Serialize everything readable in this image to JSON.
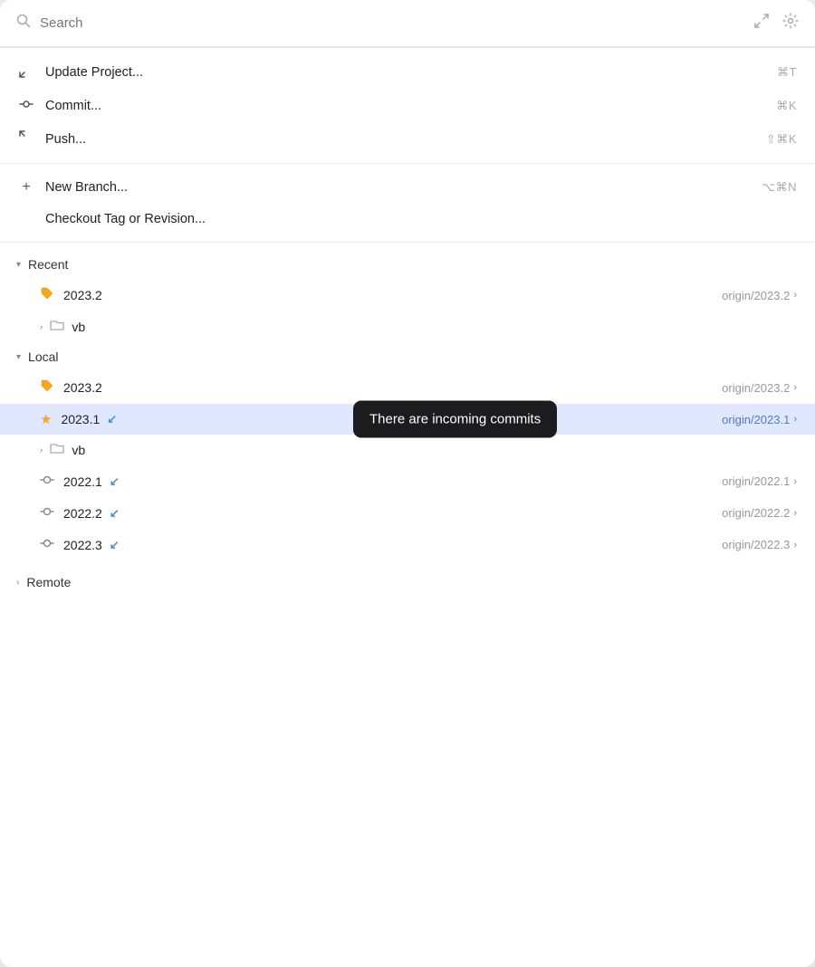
{
  "search": {
    "placeholder": "Search",
    "icon": "🔍",
    "resize_icon": "⤢",
    "settings_icon": "⚙"
  },
  "menu": {
    "sections": [
      {
        "items": [
          {
            "id": "update-project",
            "icon": "↙",
            "label": "Update Project...",
            "shortcut": "⌘T"
          },
          {
            "id": "commit",
            "icon": "○",
            "label": "Commit...",
            "shortcut": "⌘K"
          },
          {
            "id": "push",
            "icon": "↗",
            "label": "Push...",
            "shortcut": "⇧⌘K"
          }
        ]
      },
      {
        "items": [
          {
            "id": "new-branch",
            "icon": "+",
            "label": "New Branch...",
            "shortcut": "⌥⌘N"
          },
          {
            "id": "checkout-tag",
            "icon": "",
            "label": "Checkout Tag or Revision...",
            "shortcut": ""
          }
        ]
      }
    ]
  },
  "branches": {
    "recent_label": "Recent",
    "local_label": "Local",
    "remote_label": "Remote",
    "recent_items": [
      {
        "id": "recent-2023.2",
        "type": "tag",
        "name": "2023.2",
        "origin": "origin/2023.2",
        "has_arrow": false,
        "active": false
      },
      {
        "id": "recent-vb",
        "type": "folder",
        "name": "vb"
      }
    ],
    "local_items": [
      {
        "id": "local-2023.2",
        "type": "tag",
        "name": "2023.2",
        "origin": "origin/2023.2",
        "has_arrow": false,
        "active": false
      },
      {
        "id": "local-2023.1",
        "type": "star",
        "name": "2023.1",
        "origin": "origin/2023.1",
        "has_arrow": true,
        "active": true,
        "tooltip": "There are incoming commits"
      },
      {
        "id": "local-vb",
        "type": "folder",
        "name": "vb"
      },
      {
        "id": "local-2022.1",
        "type": "commit",
        "name": "2022.1",
        "origin": "origin/2022.1",
        "has_arrow": true,
        "active": false
      },
      {
        "id": "local-2022.2",
        "type": "commit",
        "name": "2022.2",
        "origin": "origin/2022.2",
        "has_arrow": true,
        "active": false
      },
      {
        "id": "local-2022.3",
        "type": "commit",
        "name": "2022.3",
        "origin": "origin/2022.3",
        "has_arrow": true,
        "active": false
      }
    ]
  },
  "icons": {
    "search": "search-icon",
    "settings": "gear-icon",
    "resize": "resize-icon",
    "update_project": "update-project-icon",
    "commit": "commit-icon",
    "push": "push-icon",
    "new_branch": "new-branch-icon",
    "chevron_down": "chevron-down-icon",
    "chevron_right": "chevron-right-icon",
    "folder": "folder-icon",
    "tag": "tag-icon",
    "star": "star-icon",
    "branch": "branch-icon"
  }
}
